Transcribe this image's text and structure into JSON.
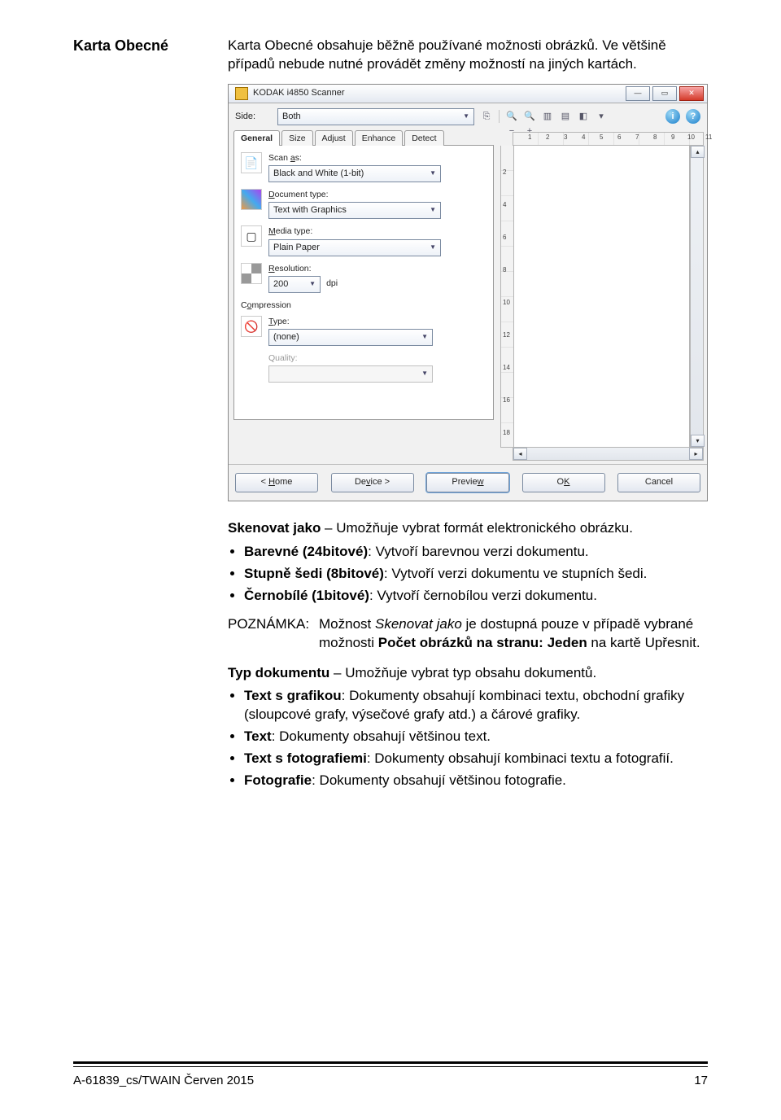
{
  "doc": {
    "heading": "Karta Obecné",
    "intro": "Karta Obecné obsahuje běžně používané možnosti obrázků. Ve většině případů nebude nutné provádět změny možností na jiných kartách.",
    "scan_as_lead": "Skenovat jako",
    "scan_as_text": " – Umožňuje vybrat formát elektronického obrázku.",
    "scan_as_items": {
      "color": {
        "term": "Barevné (24bitové)",
        "rest": ": Vytvoří barevnou verzi dokumentu."
      },
      "gray": {
        "term": "Stupně šedi (8bitové)",
        "rest": ": Vytvoří verzi dokumentu ve stupních šedi."
      },
      "bw": {
        "term": "Černobílé (1bitové)",
        "rest": ": Vytvoří černobílou verzi dokumentu."
      }
    },
    "note_label": "POZNÁMKA:",
    "note_text_pre": "Možnost ",
    "note_scan_as": "Skenovat jako",
    "note_text_mid": " je dostupná pouze v případě vybrané možnosti ",
    "note_bold": "Počet obrázků na stranu: Jeden",
    "note_text_end": " na kartě Upřesnit.",
    "doc_type_lead": "Typ dokumentu",
    "doc_type_text": " – Umožňuje vybrat typ obsahu dokumentů.",
    "doc_type_items": {
      "text_graphics": {
        "term": "Text s grafikou",
        "rest": ": Dokumenty obsahují kombinaci textu, obchodní grafiky (sloupcové grafy, výsečové grafy atd.) a čárové grafiky."
      },
      "text": {
        "term": "Text",
        "rest": ": Dokumenty obsahují většinou text."
      },
      "text_photos": {
        "term": "Text s fotografiemi",
        "rest": ": Dokumenty obsahují kombinaci textu a fotografií."
      },
      "photos": {
        "term": "Fotografie",
        "rest": ": Dokumenty obsahují většinou fotografie."
      }
    },
    "footer_left": "A-61839_cs/TWAIN  Červen 2015",
    "footer_right": "17"
  },
  "dlg": {
    "title": "KODAK i4850 Scanner",
    "win_min": "—",
    "win_max": "▭",
    "win_close": "✕",
    "side_label": "Side:",
    "side_value": "Both",
    "icon_copy": "⎘",
    "zoom_out": "🔍−",
    "zoom_in": "🔍+",
    "tool_a": "▥",
    "tool_b": "▤",
    "color_swatch": "◧",
    "tool_split": "▾",
    "info_i": "i",
    "info_q": "?",
    "tabs": {
      "general": "General",
      "size": "Size",
      "adjust": "Adjust",
      "enhance": "Enhance",
      "detect": "Detect"
    },
    "scan_as_label": "Scan as:",
    "scan_as_value": "Black and White (1-bit)",
    "doc_type_label": "Document type:",
    "doc_type_value": "Text with Graphics",
    "media_type_label": "Media type:",
    "media_type_value": "Plain Paper",
    "resolution_label": "Resolution:",
    "resolution_value": "200",
    "resolution_unit": "dpi",
    "compression_label": "Compression",
    "comp_type_label": "Type:",
    "comp_type_value": "(none)",
    "quality_label": "Quality:",
    "quality_value": "",
    "ruler_h_vals": [
      "1",
      "2",
      "3",
      "4",
      "5",
      "6",
      "7",
      "8",
      "9",
      "10",
      "11"
    ],
    "ruler_v_vals": [
      "2",
      "4",
      "6",
      "8",
      "10",
      "12",
      "14",
      "16",
      "18"
    ],
    "buttons": {
      "home": "< Home",
      "device": "Device >",
      "preview": "Preview",
      "ok": "OK",
      "cancel": "Cancel"
    }
  }
}
